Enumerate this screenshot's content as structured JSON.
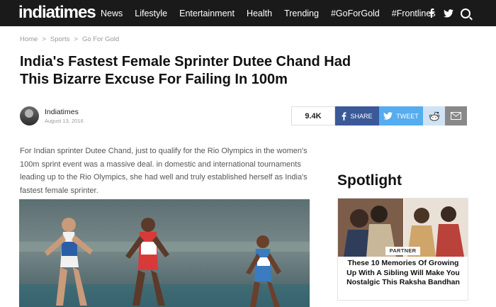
{
  "header": {
    "logo": "indiatimes",
    "nav": [
      "News",
      "Lifestyle",
      "Entertainment",
      "Health",
      "Trending",
      "#GoForGold",
      "#Frontlines"
    ],
    "icons": [
      "facebook-icon",
      "twitter-icon",
      "search-icon"
    ]
  },
  "breadcrumb": [
    "Home",
    "Sports",
    "Go For Gold"
  ],
  "article": {
    "title": "India's Fastest Female Sprinter Dutee Chand Had This Bizarre Excuse For Failing In 100m",
    "author": "Indiatimes",
    "date": "August 13, 2016",
    "lead": "For Indian sprinter Dutee Chand, just to qualify for the Rio Olympics in the women's 100m sprint event was a massive deal. in domestic and international tournaments leading up to the Rio Olympics, she had well and truly established herself as India's fastest female sprinter."
  },
  "share": {
    "count": "9.4K",
    "facebook_label": "SHARE",
    "twitter_label": "TWEET"
  },
  "sidebar": {
    "title": "Spotlight",
    "card": {
      "badge": "PARTNER",
      "headline": "These 10 Memories Of Growing Up With A Sibling Will Make You Nostalgic This Raksha Bandhan"
    }
  },
  "colors": {
    "topbar": "#1a1a1a",
    "facebook": "#3b5998",
    "twitter": "#55acee",
    "reddit": "#cfe3f5",
    "mail": "#888888"
  }
}
